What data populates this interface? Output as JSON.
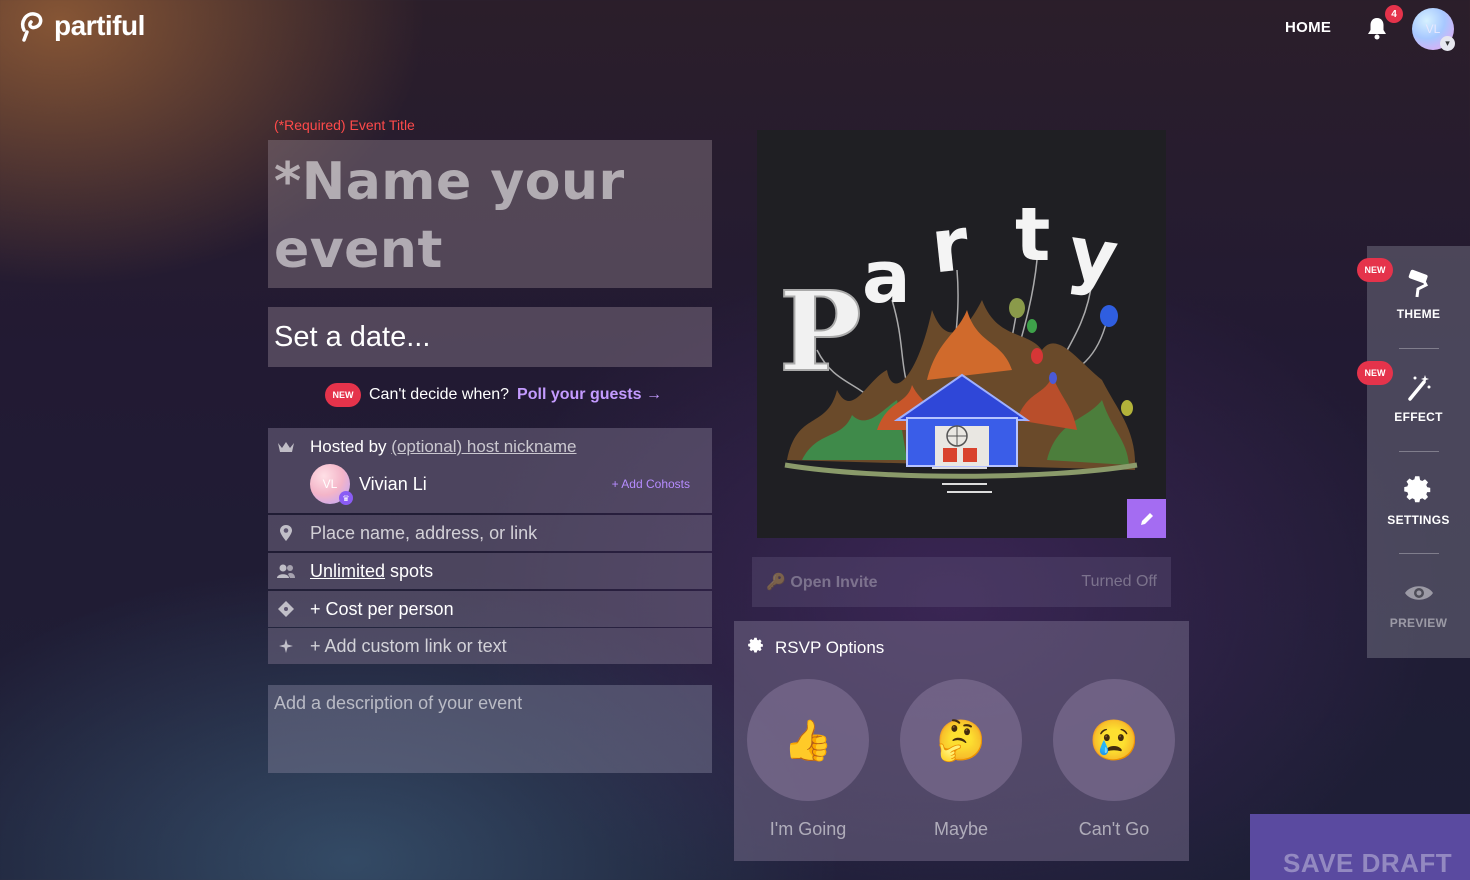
{
  "header": {
    "brand": "partiful",
    "home_label": "HOME",
    "notification_count": "4",
    "avatar_initials": "VL"
  },
  "form": {
    "required_label": "(*Required) Event Title",
    "title_placeholder": "*Name your event",
    "date_placeholder": "Set a date...",
    "poll": {
      "badge": "NEW",
      "question": "Can't decide when?",
      "link": "Poll your guests →"
    },
    "host": {
      "prefix": "Hosted by",
      "nickname_link": "(optional) host nickname",
      "avatar_initials": "VL",
      "name": "Vivian Li",
      "add_cohosts": "+ Add Cohosts"
    },
    "location_placeholder": "Place name, address, or link",
    "spots": {
      "link": "Unlimited",
      "suffix": "spots"
    },
    "cost_label": "+ Cost per person",
    "custom_link_label": "+ Add custom link or text",
    "description_placeholder": "Add a description of your event"
  },
  "poster": {
    "letters": [
      "P",
      "a",
      "r",
      "t",
      "y"
    ],
    "colors": {
      "background": "#1f1f23",
      "house": "#3a5de8",
      "edit_button": "#a46cf2"
    }
  },
  "open_invite": {
    "label": "Open Invite",
    "status": "Turned Off"
  },
  "rsvp": {
    "title": "RSVP Options",
    "options": [
      {
        "emoji": "👍",
        "label": "I'm Going"
      },
      {
        "emoji": "🤔",
        "label": "Maybe"
      },
      {
        "emoji": "😢",
        "label": "Can't Go"
      }
    ]
  },
  "sidebar": {
    "items": [
      {
        "label": "THEME",
        "icon": "paint-roller-icon",
        "badge": "NEW"
      },
      {
        "label": "EFFECT",
        "icon": "magic-wand-icon",
        "badge": "NEW"
      },
      {
        "label": "SETTINGS",
        "icon": "gear-icon"
      },
      {
        "label": "PREVIEW",
        "icon": "eye-icon"
      }
    ]
  },
  "save_draft_label": "SAVE DRAFT",
  "colors": {
    "accent": "#a46cf2",
    "badge_red": "#e5334b",
    "link_purple": "#c49bff"
  }
}
